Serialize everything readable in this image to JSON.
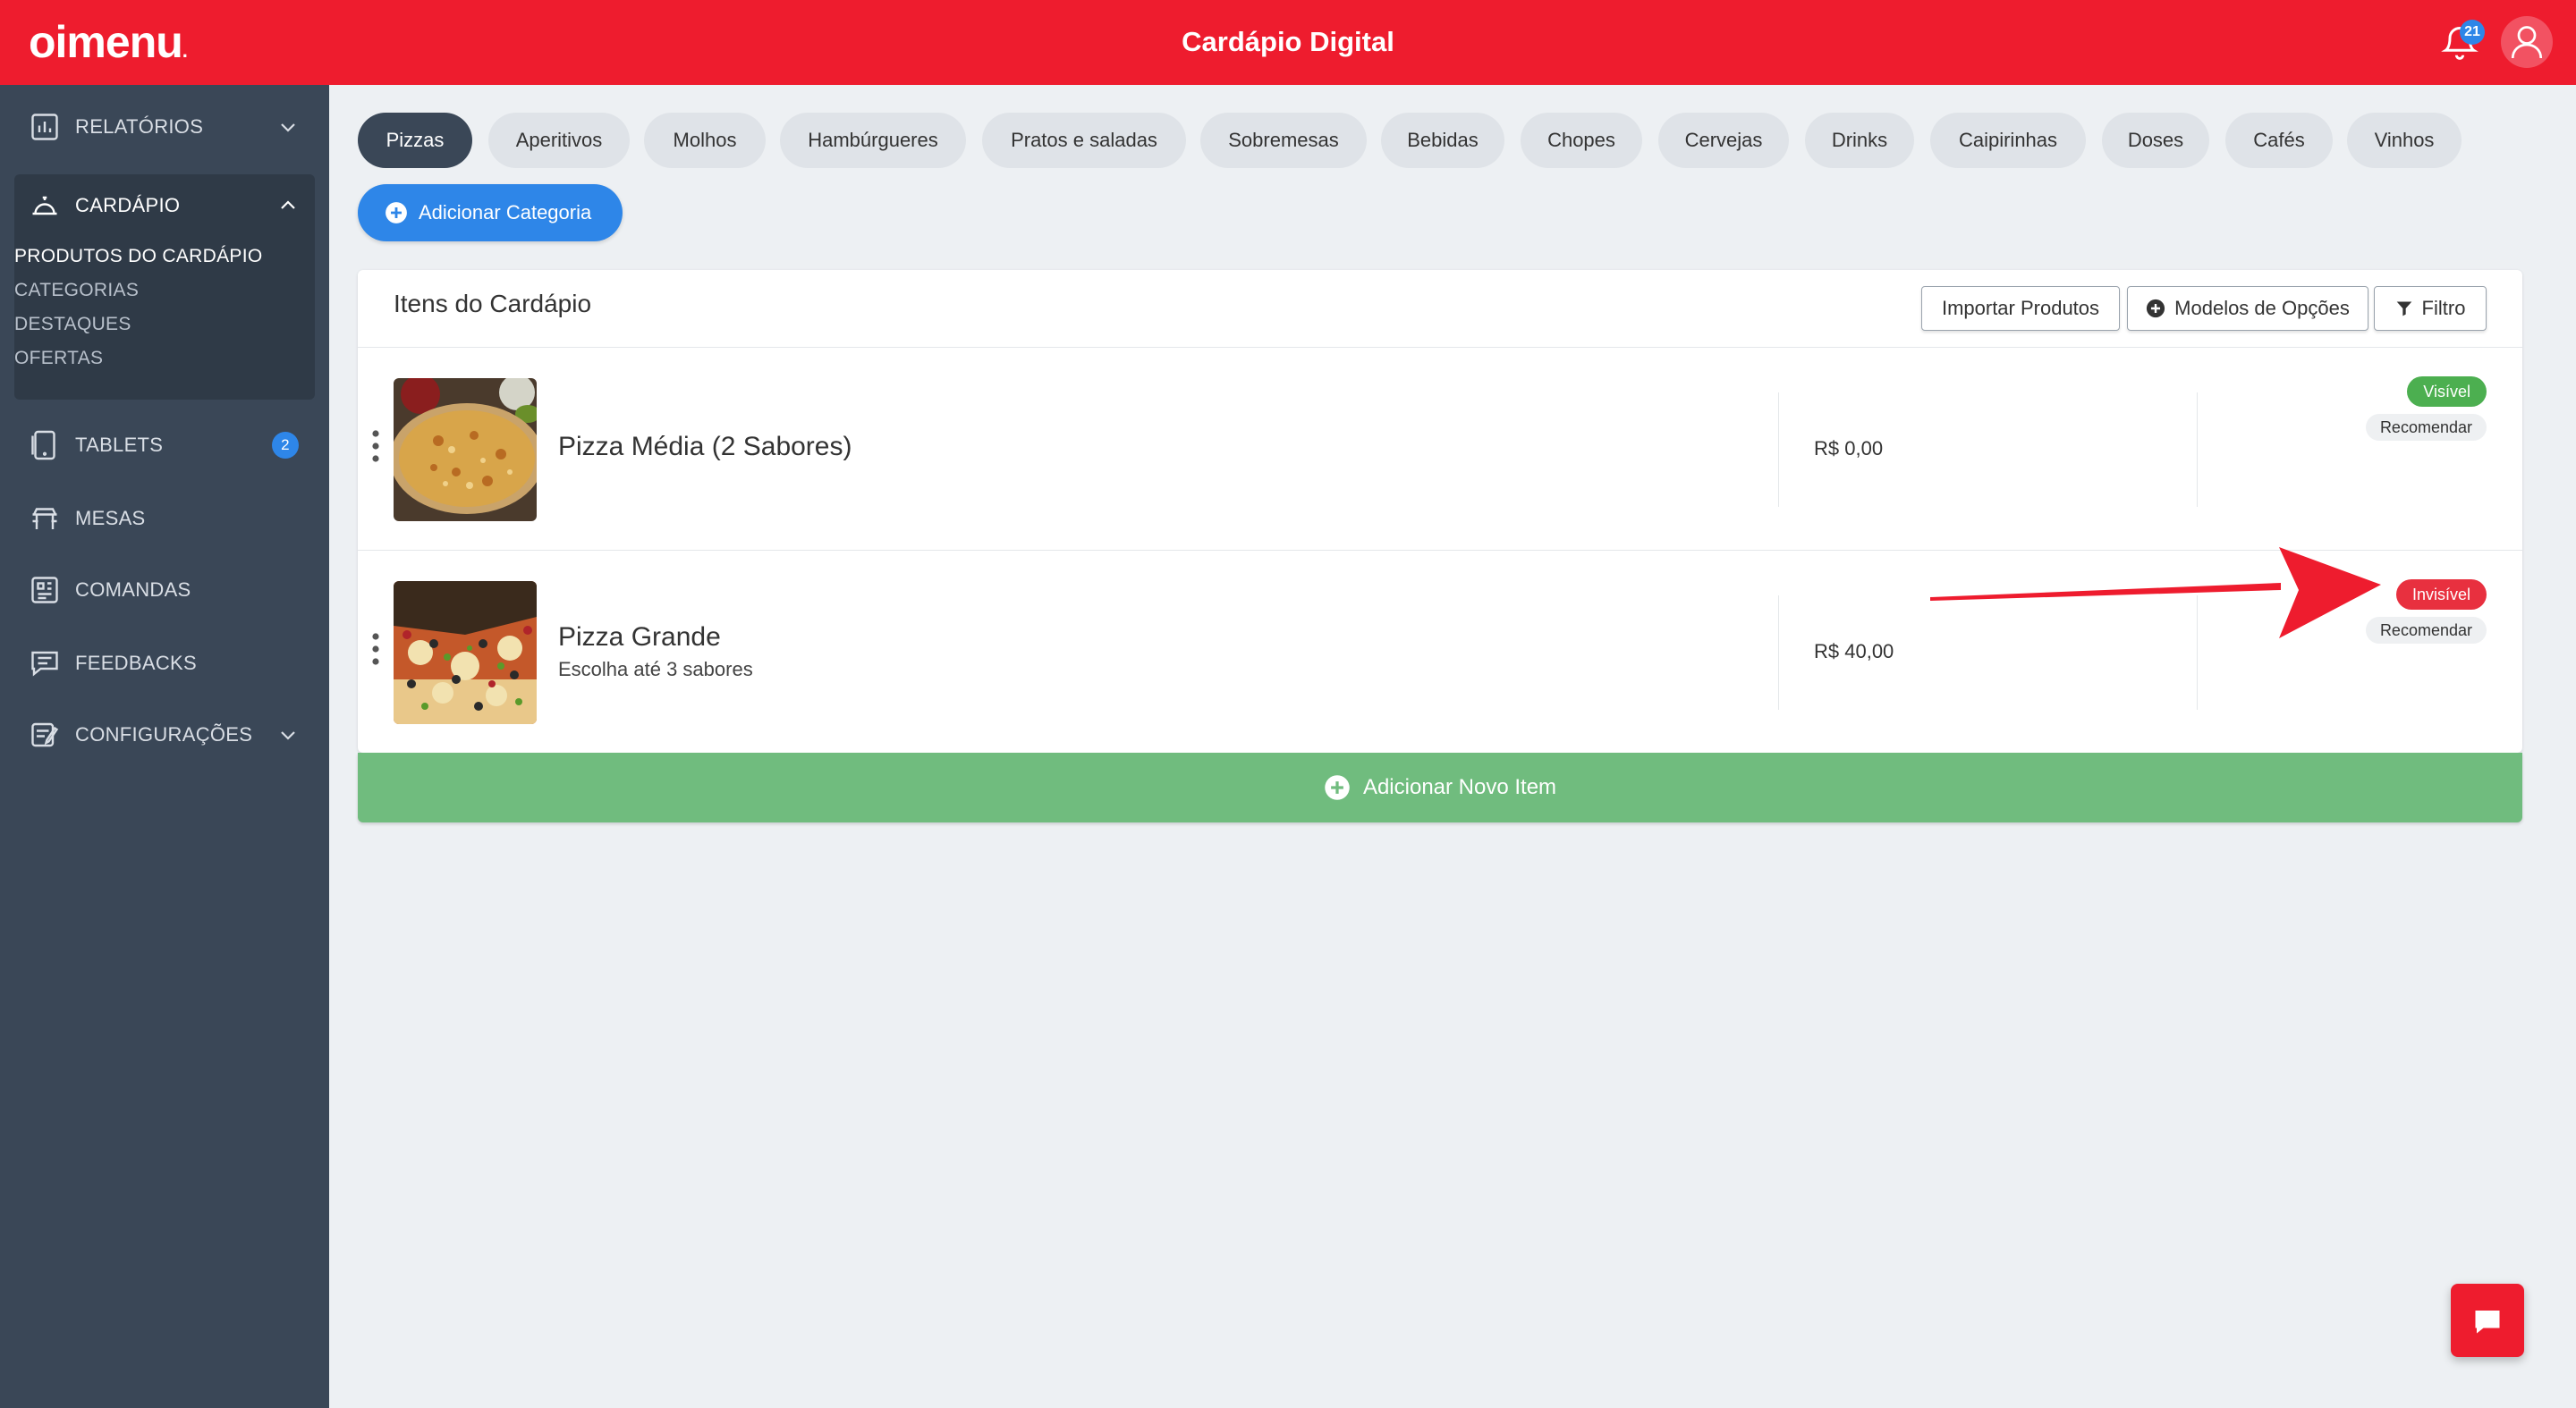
{
  "header": {
    "logo_text": "oimenu",
    "logo_dot": ".",
    "title": "Cardápio Digital",
    "notifications_count": "21",
    "brand_color": "#ee1c2e"
  },
  "sidebar": {
    "items": [
      {
        "label": "RELATÓRIOS",
        "icon": "chart-icon",
        "expandable": true
      },
      {
        "label": "CARDÁPIO",
        "icon": "cloche-icon",
        "expanded": true
      },
      {
        "label": "TABLETS",
        "icon": "tablet-icon",
        "badge": "2"
      },
      {
        "label": "MESAS",
        "icon": "table-icon"
      },
      {
        "label": "COMANDAS",
        "icon": "qr-icon"
      },
      {
        "label": "FEEDBACKS",
        "icon": "chat-icon"
      },
      {
        "label": "CONFIGURAÇÕES",
        "icon": "settings-icon",
        "expandable": true
      }
    ],
    "cardapio_sub": [
      {
        "label": "PRODUTOS DO CARDÁPIO",
        "active": true
      },
      {
        "label": "CATEGORIAS"
      },
      {
        "label": "DESTAQUES"
      },
      {
        "label": "OFERTAS"
      }
    ]
  },
  "categories": {
    "pills": [
      "Pizzas",
      "Aperitivos",
      "Molhos",
      "Hambúrgueres",
      "Pratos e saladas",
      "Sobremesas",
      "Bebidas",
      "Chopes",
      "Cervejas",
      "Drinks",
      "Caipirinhas",
      "Doses",
      "Cafés",
      "Vinhos"
    ],
    "active": "Pizzas",
    "add_label": "Adicionar Categoria"
  },
  "menu_items": {
    "title": "Itens do Cardápio",
    "import_label": "Importar Produtos",
    "models_label": "Modelos de Opções",
    "filter_label": "Filtro",
    "items": [
      {
        "name": "Pizza Média (2 Sabores)",
        "description": "",
        "price": "R$ 0,00",
        "status": "Visível",
        "recommend": "Recomendar"
      },
      {
        "name": "Pizza Grande",
        "description": "Escolha até 3 sabores",
        "price": "R$ 40,00",
        "status": "Invisível",
        "recommend": "Recomendar"
      }
    ],
    "add_item_label": "Adicionar Novo Item"
  }
}
